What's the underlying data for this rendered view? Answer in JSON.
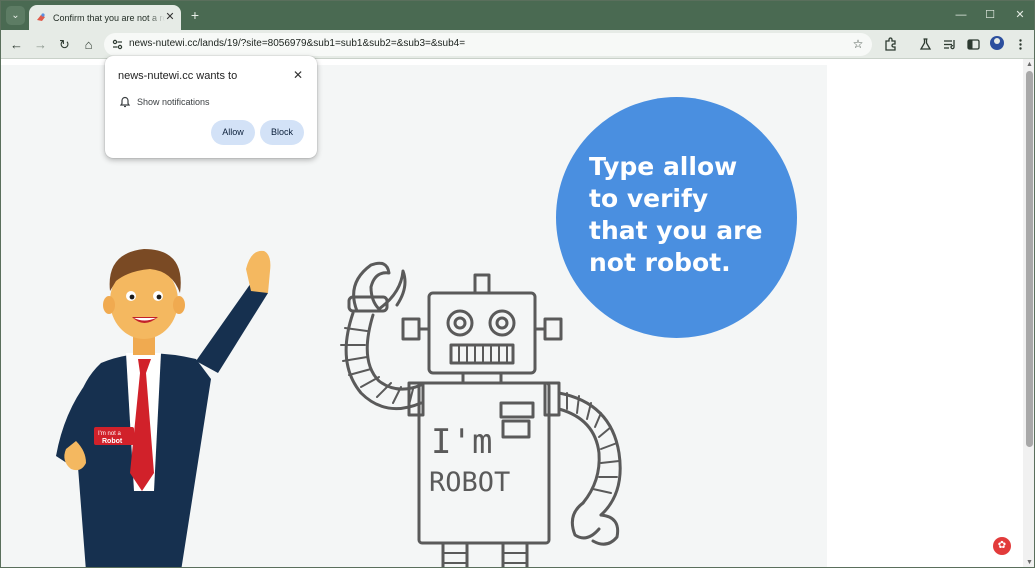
{
  "browser": {
    "tab": {
      "title": "Confirm that you are not a robot",
      "close_icon": "close-icon"
    },
    "new_tab_label": "+",
    "window_controls": {
      "minimize": "—",
      "maximize": "☐",
      "close": "✕"
    },
    "toolbar": {
      "back": "←",
      "forward": "→",
      "reload": "↻",
      "home": "⌂",
      "url_host": "news-nutewi.cc",
      "url_path": "/lands/19/?site=8056979&sub1=sub1&sub2=&sub3=&sub4=",
      "star": "☆"
    }
  },
  "permission_popup": {
    "title": "news-nutewi.cc wants to",
    "permission": "Show notifications",
    "allow_label": "Allow",
    "block_label": "Block",
    "close": "✕"
  },
  "page": {
    "bubble_text": "Type allow to verify that you are not robot.",
    "badge_text_line1": "I'm not a",
    "badge_text_line2": "Robot",
    "robot_text_line1": "I'm",
    "robot_text_line2": "ROBOT"
  },
  "colors": {
    "tabstrip": "#4a6a52",
    "bubble": "#4a8fe0",
    "suit": "#16304f",
    "tie": "#d1212a"
  }
}
